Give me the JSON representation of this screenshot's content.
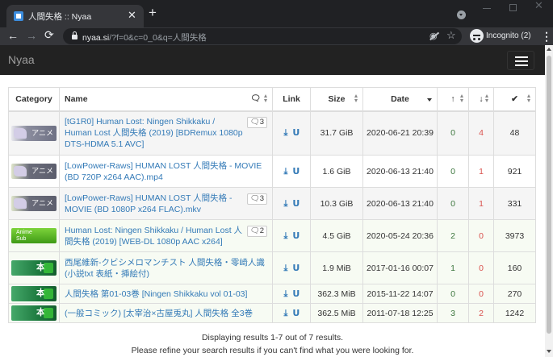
{
  "browser": {
    "tab_title": "人間失格 :: Nyaa",
    "tab_close": "✕",
    "new_tab": "+",
    "url_host": "nyaa.si",
    "url_path": "/?f=0&c=0_0&q=人間失格",
    "incognito_label": "Incognito (2)",
    "icons": {
      "back": "←",
      "forward": "→",
      "reload": "⟳",
      "star": "☆",
      "eye": "◉",
      "menu": "⋮",
      "close": "✕"
    }
  },
  "navbar": {
    "brand": "Nyaa"
  },
  "table": {
    "headers": {
      "category": "Category",
      "name": "Name",
      "comments_icon": "🗨",
      "link": "Link",
      "size": "Size",
      "date": "Date",
      "seeders": "↑",
      "leechers": "↓",
      "completed": "✔"
    },
    "rows": [
      {
        "category_type": "anime",
        "category_label": "アニメ",
        "name": "[tG1R0] Human Lost: Ningen Shikkaku / Human Lost 人間失格 (2019) [BDRemux 1080p DTS-HDMA 5.1 AVC]",
        "comments": "3",
        "size": "31.7 GiB",
        "date": "2020-06-21 20:39",
        "seeders": "0",
        "leechers": "4",
        "completed": "48"
      },
      {
        "category_type": "raw",
        "category_label": "アニメ",
        "name": "[LowPower-Raws] HUMAN LOST 人間失格 - MOVIE (BD 720P x264 AAC).mp4",
        "comments": "",
        "size": "1.6 GiB",
        "date": "2020-06-13 21:40",
        "seeders": "0",
        "leechers": "1",
        "completed": "921"
      },
      {
        "category_type": "raw",
        "category_label": "アニメ",
        "name": "[LowPower-Raws] HUMAN LOST 人間失格 - MOVIE (BD 1080P x264 FLAC).mkv",
        "comments": "3",
        "size": "10.3 GiB",
        "date": "2020-06-13 21:40",
        "seeders": "0",
        "leechers": "1",
        "completed": "331"
      },
      {
        "category_type": "sub",
        "category_label": "Anime\nSub",
        "name": "Human Lost: Ningen Shikkaku / Human Lost 人間失格 (2019) [WEB-DL 1080p AAC x264]",
        "comments": "2",
        "size": "4.5 GiB",
        "date": "2020-05-24 20:36",
        "seeders": "2",
        "leechers": "0",
        "completed": "3973"
      },
      {
        "category_type": "lit",
        "category_label": "本",
        "name": "西尾維新-クビシメロマンチスト 人間失格・零崎人識 (小説txt 表紙・挿絵付)",
        "comments": "",
        "size": "1.9 MiB",
        "date": "2017-01-16 00:07",
        "seeders": "1",
        "leechers": "0",
        "completed": "160"
      },
      {
        "category_type": "lit",
        "category_label": "本",
        "name": "人間失格 第01-03巻 [Ningen Shikkaku vol 01-03]",
        "comments": "",
        "size": "362.3 MiB",
        "date": "2015-11-22 14:07",
        "seeders": "0",
        "leechers": "0",
        "completed": "270"
      },
      {
        "category_type": "lit",
        "category_label": "本",
        "name": "(一般コミック) [太宰治×古屋兎丸] 人間失格 全3巻",
        "comments": "",
        "size": "362.5 MiB",
        "date": "2011-07-18 12:25",
        "seeders": "3",
        "leechers": "2",
        "completed": "1242"
      }
    ]
  },
  "footer": {
    "results": "Displaying results 1-7 out of 7 results.",
    "hint": "Please refine your search results if you can't find what you were looking for."
  },
  "colors": {
    "link": "#337ab7",
    "seeders": "#3c763d",
    "leechers": "#d9534f",
    "navbar": "#222222"
  }
}
